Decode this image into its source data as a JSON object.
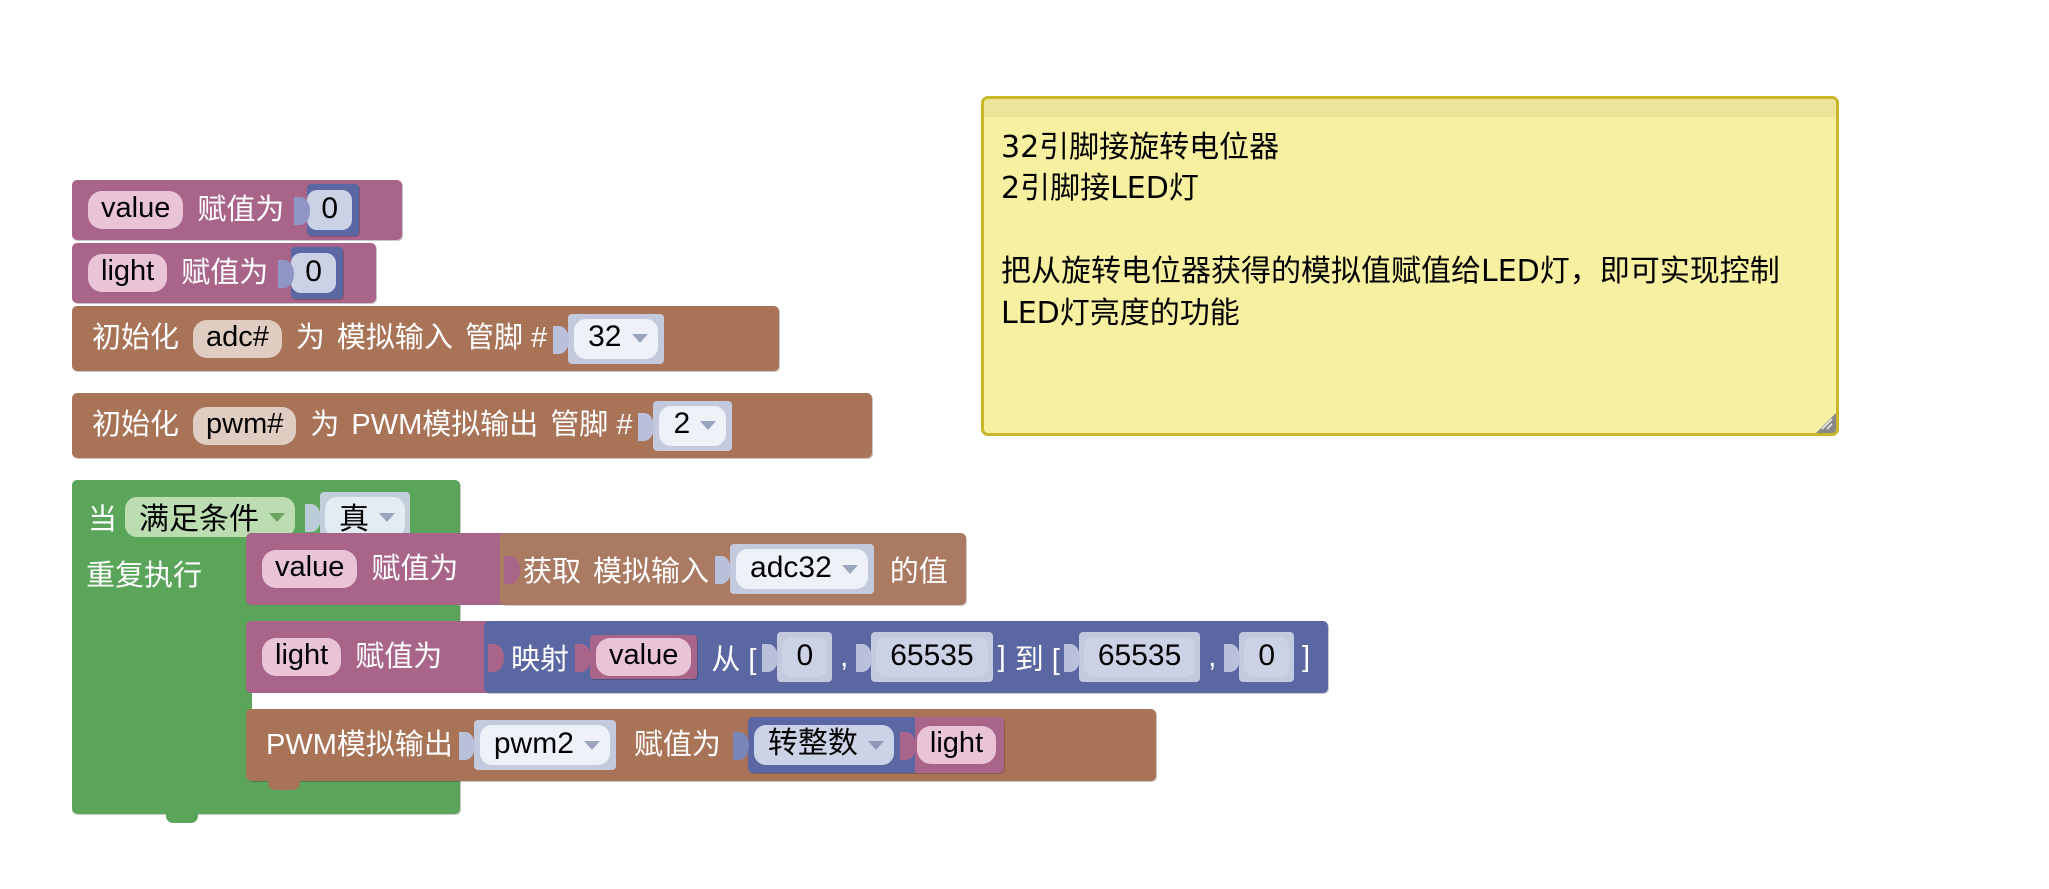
{
  "workspace": {
    "label": "blockly-workspace",
    "background": "#ffffff"
  },
  "colors": {
    "variable": "#a9648a",
    "variable_field": "#e8c4d6",
    "io": "#a97358",
    "io_field": "#e0cdc2",
    "loop": "#5ba55b",
    "loop_field": "#bcdcb1",
    "math": "#5b67a3",
    "math_field": "#cbd2e6",
    "dropdown_field": "#eef1f8",
    "comment_bg": "#f7f0a0",
    "comment_border": "#c8b728"
  },
  "blocks": {
    "set_value": {
      "var_name": "value",
      "set_label": "赋值为",
      "number": "0"
    },
    "set_light": {
      "var_name": "light",
      "set_label": "赋值为",
      "number": "0"
    },
    "init_adc": {
      "init_label": "初始化",
      "var_name": "adc#",
      "as_label": "为",
      "kind_label": "模拟输入",
      "pin_label": "管脚 #",
      "pin_value": "32"
    },
    "init_pwm": {
      "init_label": "初始化",
      "var_name": "pwm#",
      "as_label": "为",
      "kind_label": "PWM模拟输出",
      "pin_label": "管脚 #",
      "pin_value": "2"
    },
    "while_loop": {
      "while_label": "当",
      "mode_value": "满足条件",
      "condition_value": "真",
      "do_label": "重复执行"
    },
    "read_adc": {
      "var_name": "value",
      "set_label": "赋值为",
      "get_label": "获取",
      "kind_label": "模拟输入",
      "channel_value": "adc32",
      "of_value_label": "的值"
    },
    "map_light": {
      "var_name": "light",
      "set_label": "赋值为",
      "map_label": "映射",
      "source_var": "value",
      "from_label": "从 [",
      "from_min": "0",
      "comma1": ",",
      "from_max": "65535",
      "close1": "]",
      "to_label": "到 [",
      "to_min": "65535",
      "comma2": ",",
      "to_max": "0",
      "close2": "]"
    },
    "pwm_write": {
      "out_label": "PWM模拟输出",
      "channel_value": "pwm2",
      "set_label": "赋值为",
      "cast_value": "转整数",
      "source_var": "light"
    }
  },
  "comment": {
    "name": "workspace-comment",
    "text": "32引脚接旋转电位器\n2引脚接LED灯\n\n把从旋转电位器获得的模拟值赋值给LED灯，即可实现控制\nLED灯亮度的功能",
    "resize_handle": "resize-handle"
  }
}
